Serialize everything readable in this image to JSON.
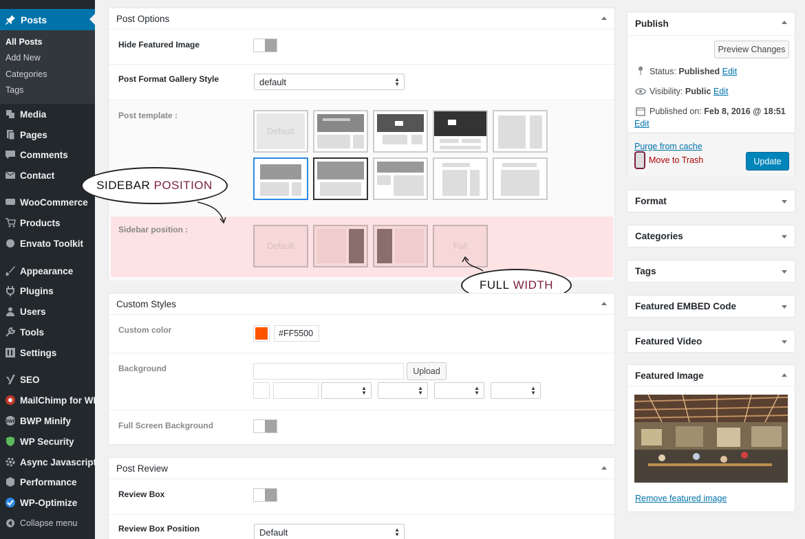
{
  "sidebar": {
    "current": "Posts",
    "submenu": [
      "All Posts",
      "Add New",
      "Categories",
      "Tags"
    ],
    "items": [
      {
        "label": "Media",
        "icon": "media-icon"
      },
      {
        "label": "Pages",
        "icon": "pages-icon"
      },
      {
        "label": "Comments",
        "icon": "comments-icon"
      },
      {
        "label": "Contact",
        "icon": "mail-icon"
      },
      {
        "label": "WooCommerce",
        "icon": "woocommerce-icon"
      },
      {
        "label": "Products",
        "icon": "cart-icon"
      },
      {
        "label": "Envato Toolkit",
        "icon": "envato-icon"
      },
      {
        "label": "Appearance",
        "icon": "brush-icon"
      },
      {
        "label": "Plugins",
        "icon": "plug-icon"
      },
      {
        "label": "Users",
        "icon": "users-icon"
      },
      {
        "label": "Tools",
        "icon": "wrench-icon"
      },
      {
        "label": "Settings",
        "icon": "settings-icon"
      },
      {
        "label": "SEO",
        "icon": "yoast-icon"
      },
      {
        "label": "MailChimp for WP",
        "icon": "mailchimp-icon"
      },
      {
        "label": "BWP Minify",
        "icon": "minify-icon"
      },
      {
        "label": "WP Security",
        "icon": "shield-icon"
      },
      {
        "label": "Async Javascript",
        "icon": "gear-icon"
      },
      {
        "label": "Performance",
        "icon": "performance-icon"
      },
      {
        "label": "WP-Optimize",
        "icon": "optimize-icon"
      }
    ],
    "collapse": "Collapse menu"
  },
  "post_options": {
    "title": "Post Options",
    "hide_featured_image": "Hide Featured Image",
    "gallery_style_label": "Post Format Gallery Style",
    "gallery_style_value": "default",
    "template_label": "Post template :",
    "template_default": "Default",
    "sidebar_label": "Sidebar position :",
    "sidebar_default": "Default",
    "sidebar_full": "Full"
  },
  "annotations": {
    "sidebar_word1": "SIDEBAR",
    "sidebar_word2": "POSITION",
    "full_word1": "FULL",
    "full_word2": "WIDTH"
  },
  "custom_styles": {
    "title": "Custom Styles",
    "color_label": "Custom color",
    "color_value": "#FF5500",
    "background_label": "Background",
    "upload": "Upload",
    "full_screen_label": "Full Screen Background"
  },
  "post_review": {
    "title": "Post Review",
    "review_box": "Review Box",
    "position_label": "Review Box Position",
    "position_value": "Default"
  },
  "publish": {
    "title": "Publish",
    "preview": "Preview Changes",
    "status_label": "Status:",
    "status_value": "Published",
    "visibility_label": "Visibility:",
    "visibility_value": "Public",
    "edit": "Edit",
    "published_label": "Published on:",
    "published_value": "Feb 8, 2016 @ 18:51",
    "purge": "Purge from cache",
    "trash": "Move to Trash",
    "update": "Update"
  },
  "boxes": {
    "format": "Format",
    "categories": "Categories",
    "tags": "Tags",
    "embed": "Featured EMBED Code",
    "video": "Featured Video",
    "image": "Featured Image",
    "remove_image": "Remove featured image"
  },
  "colors": {
    "accent": "#0073aa",
    "custom": "#FF5500",
    "highlight": "#fde3e3"
  }
}
